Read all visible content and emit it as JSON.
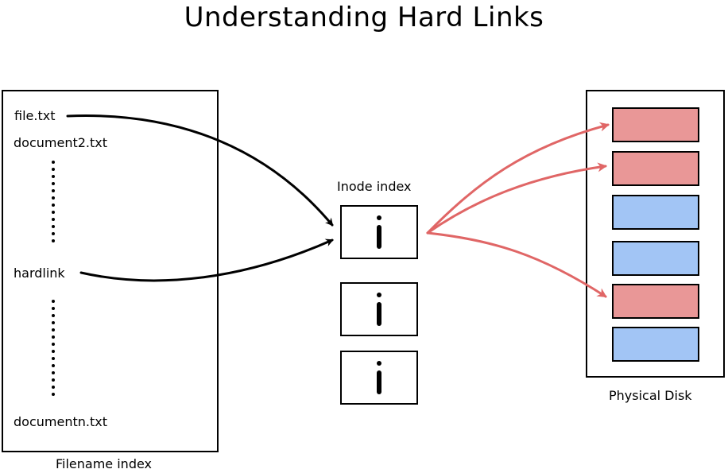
{
  "title": "Understanding Hard Links",
  "filename_index": {
    "label": "Filename index",
    "entries": [
      "file.txt",
      "document2.txt",
      "hardlink",
      "documentn.txt"
    ]
  },
  "inode_index": {
    "label": "Inode index",
    "inodes": [
      {
        "glyph": "i"
      },
      {
        "glyph": "i"
      },
      {
        "glyph": "i"
      }
    ]
  },
  "physical_disk": {
    "label": "Physical Disk",
    "blocks": [
      {
        "state": "used",
        "linked": true
      },
      {
        "state": "used",
        "linked": true
      },
      {
        "state": "free",
        "linked": false
      },
      {
        "state": "free",
        "linked": false
      },
      {
        "state": "used",
        "linked": true
      },
      {
        "state": "free",
        "linked": false
      }
    ]
  },
  "links": {
    "filename_to_inode": [
      {
        "from": "file.txt",
        "to_inode": 0
      },
      {
        "from": "hardlink",
        "to_inode": 0
      }
    ],
    "inode_to_blocks": [
      {
        "from_inode": 0,
        "to_block": 0
      },
      {
        "from_inode": 0,
        "to_block": 1
      },
      {
        "from_inode": 0,
        "to_block": 4
      }
    ]
  },
  "colors": {
    "used_block": "#e99797",
    "free_block": "#a2c5f5",
    "data_arrow": "#e06666",
    "name_arrow": "#000000"
  }
}
